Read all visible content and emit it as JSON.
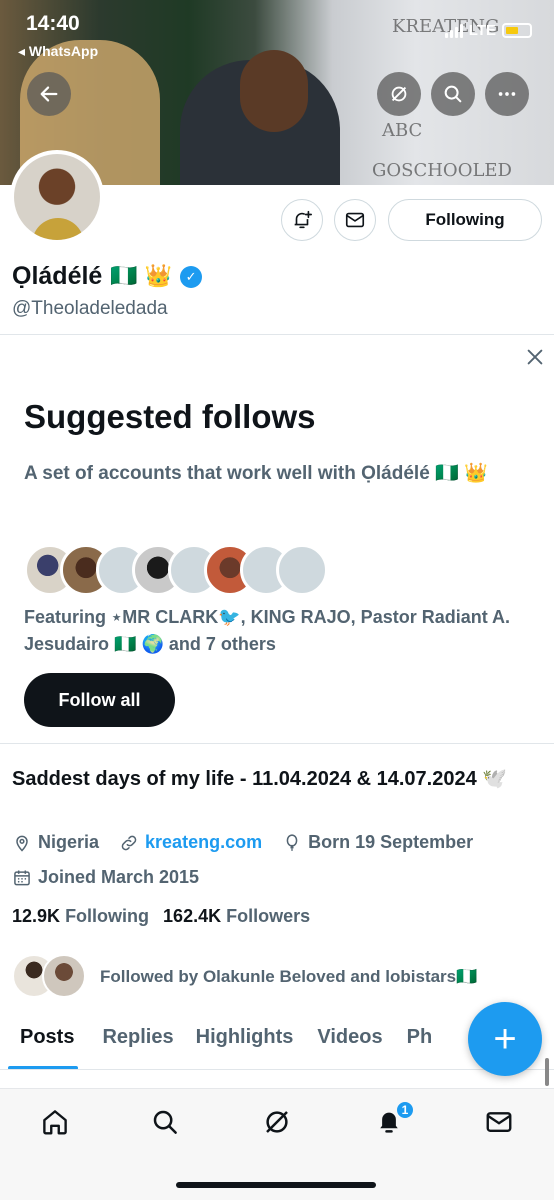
{
  "status_bar": {
    "time": "14:40",
    "back_app": "◂ WhatsApp",
    "network": "LTE"
  },
  "banner": {
    "wall_text": [
      "KREATENG",
      "ABC",
      "GOSCHOOLED"
    ]
  },
  "profile": {
    "name": "Ọládélé",
    "name_emojis": "🇳🇬 👑",
    "handle": "@Theoladeledada",
    "following_button": "Following"
  },
  "suggested": {
    "title": "Suggested follows",
    "description": "A set of accounts that work well with Ọládélé 🇳🇬 👑",
    "featuring": "Featuring ⋆MR CLARK🐦, KING RAJO, Pastor Radiant A. Jesudairo 🇳🇬 🌍 and 7 others",
    "follow_all": "Follow all"
  },
  "bio": {
    "text": "Saddest days of my life - 11.04.2024 & 14.07.2024 🕊️",
    "location": "Nigeria",
    "website": "kreateng.com",
    "born": "Born 19 September",
    "joined": "Joined March 2015"
  },
  "stats": {
    "following_count": "12.9K",
    "following_label": "Following",
    "followers_count": "162.4K",
    "followers_label": "Followers"
  },
  "followed_by": "Followed by Olakunle Beloved and lobistars🇳🇬",
  "tabs": [
    "Posts",
    "Replies",
    "Highlights",
    "Videos",
    "Ph"
  ],
  "fab_label": "+",
  "nav": {
    "notifications_badge": "1"
  },
  "colors": {
    "accent": "#1d9bf0",
    "text": "#0f1419",
    "muted": "#536471"
  }
}
